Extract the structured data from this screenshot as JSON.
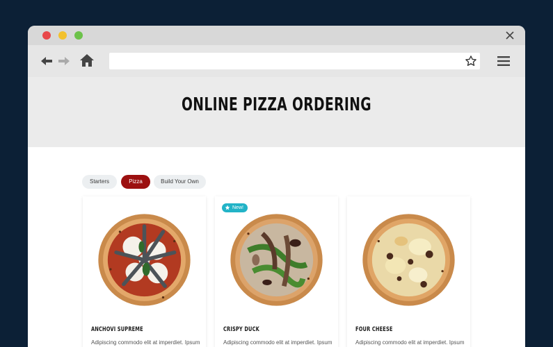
{
  "browser": {
    "url": "",
    "icons": [
      "back-arrow-icon",
      "forward-arrow-icon",
      "home-icon",
      "bookmark-star-icon",
      "hamburger-menu-icon",
      "close-icon"
    ],
    "traffic_lights": {
      "red": "#e8474a",
      "yellow": "#f2c12e",
      "green": "#6cc24a"
    }
  },
  "page": {
    "title": "ONLINE PIZZA ORDERING"
  },
  "tabs": [
    {
      "label": "Starters",
      "active": false
    },
    {
      "label": "Pizza",
      "active": true
    },
    {
      "label": "Build Your Own",
      "active": false
    }
  ],
  "menu_items": [
    {
      "name": "ANCHOVI SUPREME",
      "description": "Adipiscing commodo elit at imperdiet. Ipsum",
      "badge": ""
    },
    {
      "name": "CRISPY DUCK",
      "description": "Adipiscing commodo elit at imperdiet. Ipsum",
      "badge": "New!"
    },
    {
      "name": "FOUR CHEESE",
      "description": "Adipiscing commodo elit at imperdiet. Ipsum",
      "badge": ""
    }
  ],
  "colors": {
    "background": "#0c2036",
    "accent": "#9c1010",
    "badge": "#22b3c7"
  }
}
